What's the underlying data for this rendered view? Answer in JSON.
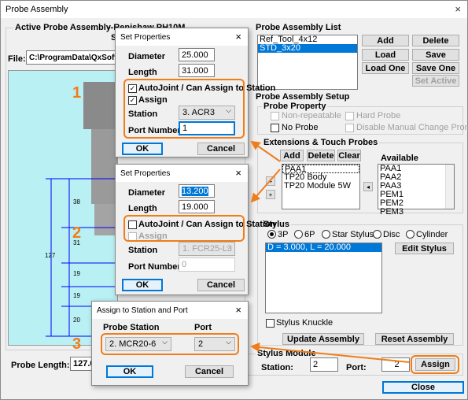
{
  "window": {
    "title": "Probe Assembly",
    "close": "×"
  },
  "active": {
    "label": "Active Probe Assembly",
    "name": "--Renishaw PH10M",
    "sub": "ST"
  },
  "file": {
    "label": "File:",
    "value": "C:\\ProgramData\\QxSoft\\CMM-"
  },
  "probe_length": {
    "label": "Probe Length:",
    "value": "127.00"
  },
  "dims": {
    "d38": "38",
    "d31": "31",
    "d127": "127",
    "d19a": "19",
    "d19b": "19",
    "d20": "20"
  },
  "list": {
    "title": "Probe Assembly List",
    "items": [
      "Ref_Tool_4x12",
      "STD_3x20"
    ],
    "selected": 1,
    "buttons": {
      "add": "Add",
      "delete": "Delete",
      "load": "Load",
      "save": "Save",
      "load_one": "Load One",
      "save_one": "Save One",
      "set_active": "Set Active"
    }
  },
  "setup": {
    "title": "Probe Assembly Setup",
    "property_title": "Probe Property",
    "non_repeatable": "Non-repeatable",
    "hard_probe": "Hard Probe",
    "no_probe": "No Probe",
    "disable_manual": "Disable Manual Change Prompt"
  },
  "extensions": {
    "title": "Extensions & Touch Probes",
    "add": "Add",
    "delete": "Delete",
    "clear": "Clear",
    "items": [
      "PAA1",
      "TP20 Body",
      "TP20 Module 5W"
    ],
    "available_label": "Available",
    "available": [
      "PAA1",
      "PAA2",
      "PAA3",
      "PEM1",
      "PEM2",
      "PEM3"
    ],
    "plus": "+",
    "arrow": "◂"
  },
  "stylus": {
    "title": "Stylus",
    "options": [
      "3P",
      "6P",
      "Star Stylus",
      "Disc",
      "Cylinder"
    ],
    "items": [
      "D = 3.000, L = 20.000"
    ],
    "edit": "Edit Stylus",
    "knuckle": "Stylus Knuckle",
    "update": "Update Assembly",
    "reset": "Reset Assembly"
  },
  "stylus_module": {
    "title": "Stylus Module",
    "station_label": "Station:",
    "station": "2",
    "port_label": "Port:",
    "port": "2",
    "assign": "Assign"
  },
  "close_button": "Close",
  "dialog1": {
    "title": "Set Properties",
    "close": "×",
    "diameter_label": "Diameter",
    "diameter": "25.000",
    "length_label": "Length",
    "length": "31.000",
    "autojoint": "AutoJoint / Can Assign to Station",
    "autojoint_checked": "✓",
    "assign": "Assign",
    "assign_checked": "✓",
    "station_label": "Station",
    "station": "3. ACR3",
    "port_label": "Port Number",
    "port": "1",
    "ok": "OK",
    "cancel": "Cancel"
  },
  "dialog2": {
    "title": "Set Properties",
    "close": "×",
    "diameter_label": "Diameter",
    "diameter": "13.200",
    "length_label": "Length",
    "length": "19.000",
    "autojoint": "AutoJoint / Can Assign to Station",
    "assign": "Assign",
    "station_label": "Station",
    "station": "1. FCR25-L3",
    "port_label": "Port Number",
    "port": "0",
    "ok": "OK",
    "cancel": "Cancel"
  },
  "dialog3": {
    "title": "Assign to Station and Port",
    "close": "×",
    "station_label": "Probe Station",
    "station": "2. MCR20-6",
    "port_label": "Port",
    "port": "2",
    "ok": "OK",
    "cancel": "Cancel"
  },
  "steps": [
    "1",
    "2",
    "3"
  ],
  "colors": {
    "accent": "#f07d1a",
    "preview_bg": "#b8f0f4",
    "select": "#0078d7",
    "dim_line": "#0000ff"
  }
}
